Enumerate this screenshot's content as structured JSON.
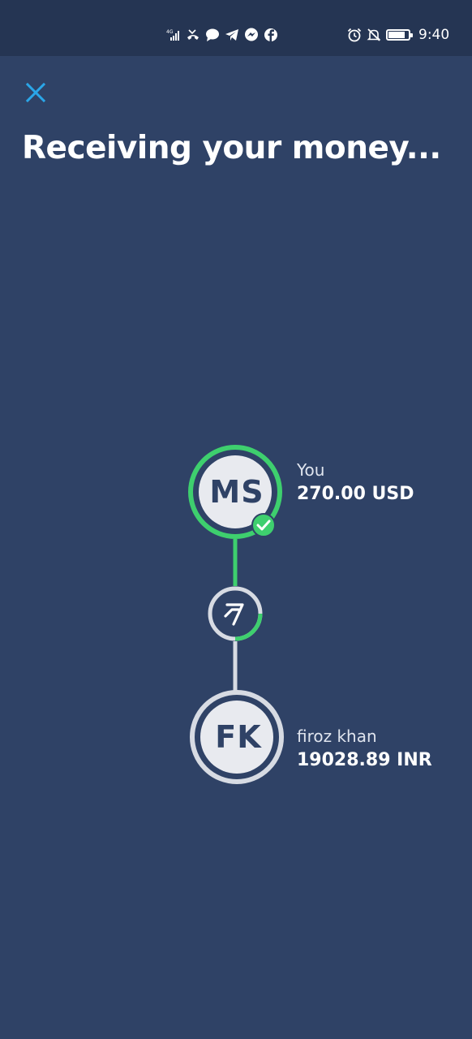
{
  "status_bar": {
    "network": "4G",
    "time": "9:40",
    "left_icons": [
      "signal-icon",
      "missed-call-icon",
      "chat-icon",
      "telegram-icon",
      "messenger-icon",
      "facebook-icon"
    ],
    "right_icons": [
      "alarm-icon",
      "mute-icon",
      "battery-icon"
    ]
  },
  "header": {
    "close_icon": "close-icon",
    "title": "Receiving your money..."
  },
  "transfer": {
    "sender": {
      "initials": "MS",
      "name": "You",
      "amount": "270.00 USD",
      "status": "complete"
    },
    "provider_icon": "wise-logo-icon",
    "recipient": {
      "initials": "FK",
      "name": "firoz khan",
      "amount": "19028.89 INR"
    }
  },
  "colors": {
    "background": "#2f4266",
    "status_bar": "#253553",
    "accent_green": "#3ecf6e",
    "close_blue": "#2aa6e8",
    "ring_gray": "#d7dbe3",
    "avatar_fill": "#e8eaef"
  }
}
